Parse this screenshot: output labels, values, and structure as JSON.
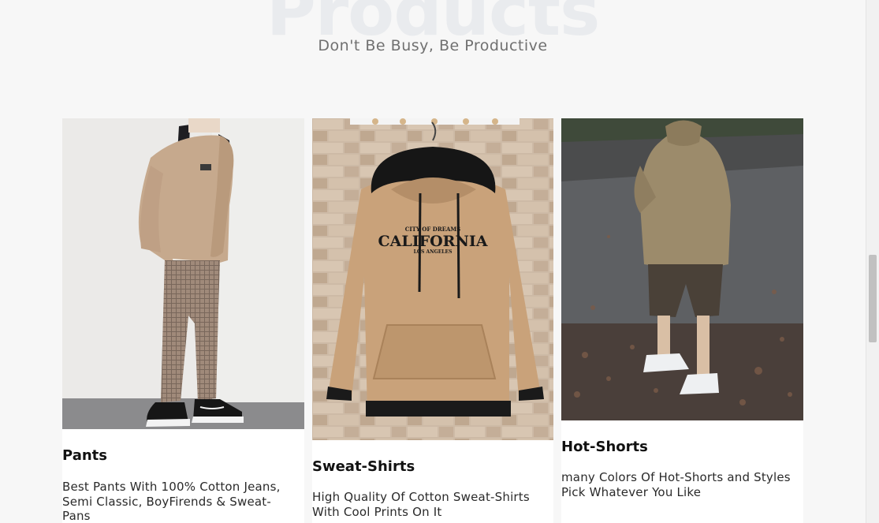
{
  "section": {
    "background_title": "Products",
    "subtitle": "Don't Be Busy, Be Productive"
  },
  "products": [
    {
      "title": "Pants",
      "description": "Best Pants With 100% Cotton Jeans, Semi Classic, BoyFirends & Sweat-Pans",
      "image": "man-in-beige-sweater-and-plaid-pants-photo"
    },
    {
      "title": "Sweat-Shirts",
      "description": "High Quality Of Cotton Sweat-Shirts With Cool Prints On It",
      "image": "beige-california-hoodie-on-hanger-photo",
      "print": {
        "line1": "CITY OF DREAMS",
        "line2": "CALIFORNIA",
        "line3": "LOS ANGELES"
      }
    },
    {
      "title": "Hot-Shorts",
      "description": "many Colors Of Hot-Shorts and Styles Pick Whatever You Like",
      "image": "man-in-hoodie-and-shorts-on-street-photo"
    }
  ],
  "colors": {
    "page_bg": "#f7f7f7",
    "card_bg": "#ffffff",
    "beige": "#c4a47e",
    "title_watermark": "#e9ebee"
  }
}
